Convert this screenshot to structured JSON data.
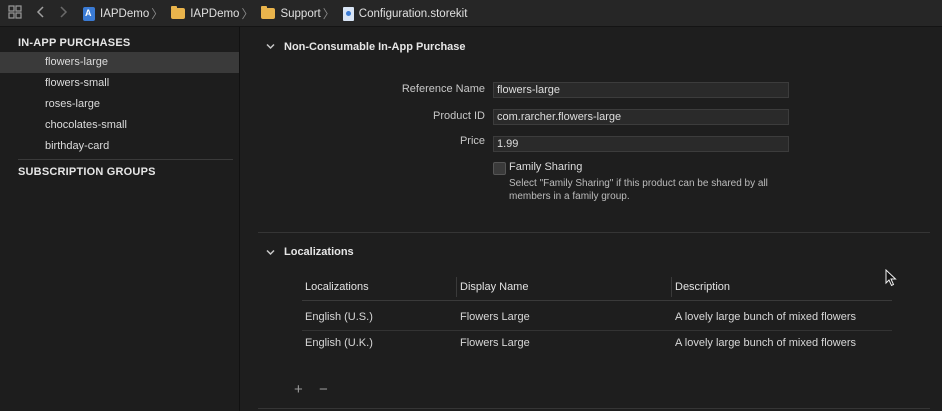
{
  "topbar": {
    "crumbs": [
      {
        "label": "IAPDemo",
        "icon": "project-icon"
      },
      {
        "label": "IAPDemo",
        "icon": "folder-icon"
      },
      {
        "label": "Support",
        "icon": "folder-icon"
      },
      {
        "label": "Configuration.storekit",
        "icon": "storekit-file-icon"
      }
    ]
  },
  "sidebar": {
    "in_app_header": "IN-APP PURCHASES",
    "items": [
      {
        "label": "flowers-large",
        "selected": true
      },
      {
        "label": "flowers-small"
      },
      {
        "label": "roses-large"
      },
      {
        "label": "chocolates-small"
      },
      {
        "label": "birthday-card"
      }
    ],
    "subscription_header": "SUBSCRIPTION GROUPS"
  },
  "product": {
    "section_title": "Non-Consumable In-App Purchase",
    "reference_name_label": "Reference Name",
    "reference_name_value": "flowers-large",
    "product_id_label": "Product ID",
    "product_id_value": "com.rarcher.flowers-large",
    "price_label": "Price",
    "price_value": "1.99",
    "family_sharing_label": "Family Sharing",
    "family_sharing_checked": false,
    "family_sharing_help": "Select \"Family Sharing\" if this product can be shared by all members in a family group."
  },
  "localizations": {
    "section_title": "Localizations",
    "columns": [
      "Localizations",
      "Display Name",
      "Description"
    ],
    "rows": [
      [
        "English (U.S.)",
        "Flowers Large",
        "A lovely large bunch of mixed flowers"
      ],
      [
        "English (U.K.)",
        "Flowers Large",
        "A lovely large bunch of mixed flowers"
      ]
    ],
    "add_symbol": "+",
    "remove_symbol": "−"
  }
}
